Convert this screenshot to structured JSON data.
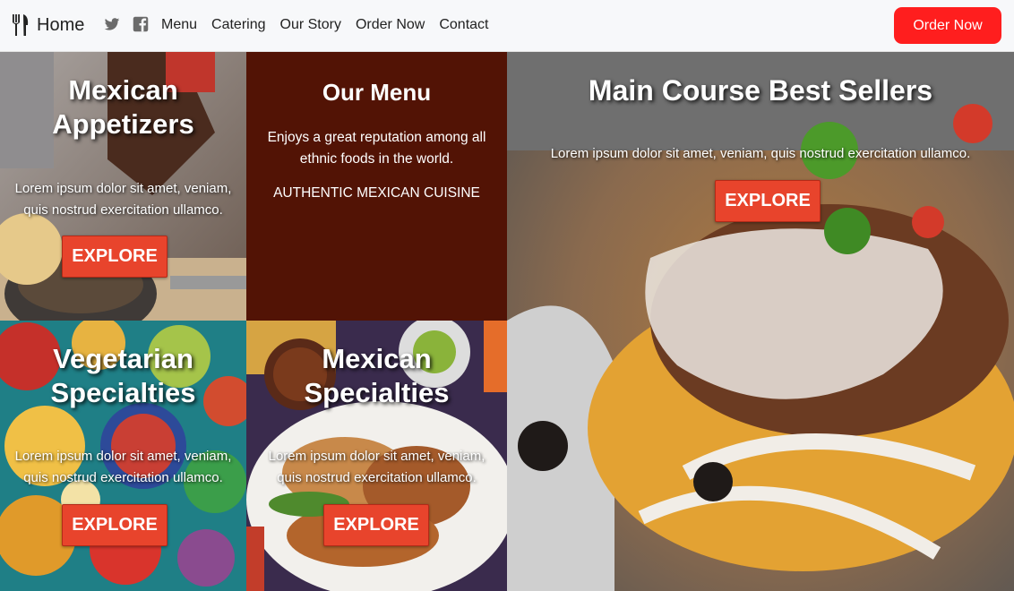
{
  "nav": {
    "brand_label": "Home",
    "brand_icon": "utensils-icon",
    "social": [
      "twitter-icon",
      "facebook-icon"
    ],
    "links": [
      "Menu",
      "Catering",
      "Our Story",
      "Order Now",
      "Contact"
    ],
    "order_button": "Order Now"
  },
  "tiles": {
    "appetizers": {
      "title_line1": "Mexican",
      "title_line2": "Appetizers",
      "description_line1": "Lorem ipsum dolor sit amet, veniam,",
      "description_line2": "quis nostrud exercitation ullamco.",
      "button": "EXPLORE"
    },
    "our_menu": {
      "title": "Our Menu",
      "description": "Enjoys a great reputation among all ethnic foods in the world.",
      "tagline": "AUTHENTIC MEXICAN CUISINE"
    },
    "vegetarian": {
      "title_line1": "Vegetarian",
      "title_line2": "Specialties",
      "description_line1": "Lorem ipsum dolor sit amet, veniam,",
      "description_line2": "quis nostrud exercitation ullamco.",
      "button": "EXPLORE"
    },
    "specialties": {
      "title_line1": "Mexican",
      "title_line2": "Specialties",
      "description_line1": "Lorem ipsum dolor sit amet, veniam,",
      "description_line2": "quis nostrud exercitation ullamco.",
      "button": "EXPLORE"
    },
    "main_course": {
      "title": "Main Course Best Sellers",
      "description": "Lorem ipsum dolor sit amet, veniam, quis nostrud exercitation ullamco.",
      "button": "EXPLORE"
    }
  },
  "colors": {
    "order_button": "#ff1e1e",
    "explore_button": "#e8442c",
    "menu_tile_bg": "#521305"
  }
}
